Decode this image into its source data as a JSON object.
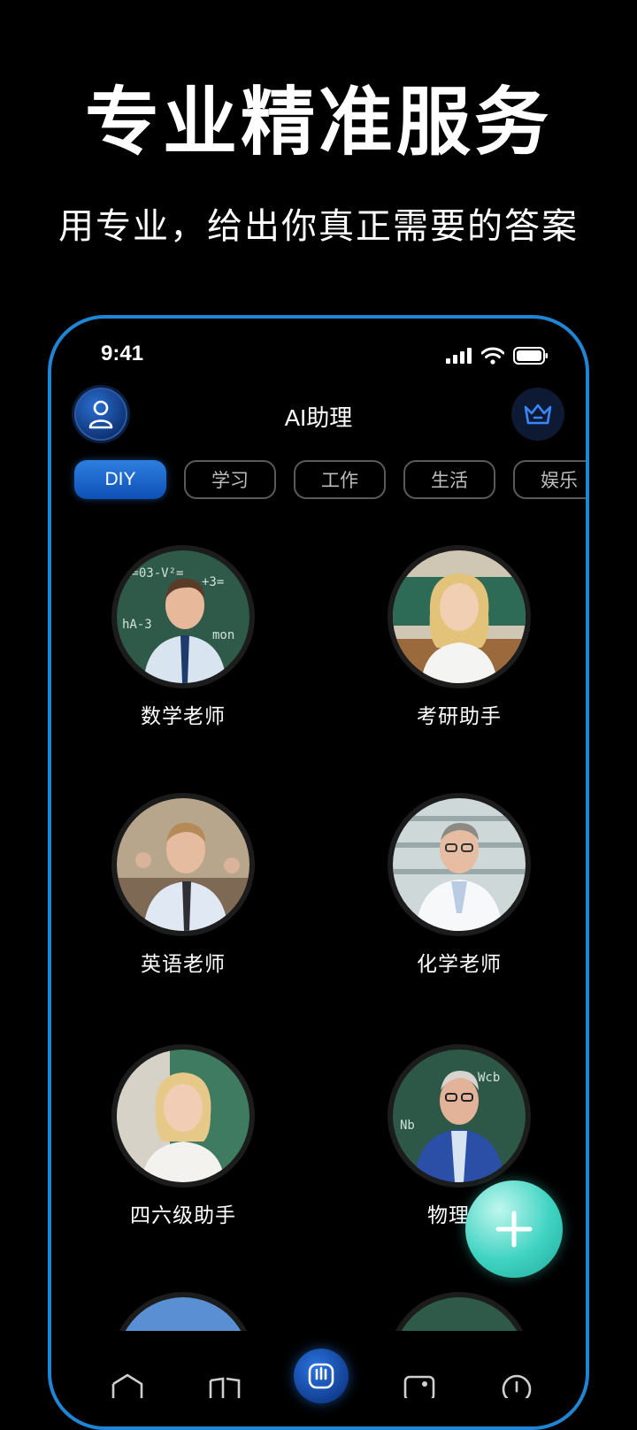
{
  "promo": {
    "headline": "专业精准服务",
    "subline": "用专业，给出你真正需要的答案"
  },
  "status_bar": {
    "time": "9:41"
  },
  "header": {
    "title": "AI助理"
  },
  "tabs": [
    {
      "label": "DIY",
      "active": true
    },
    {
      "label": "学习"
    },
    {
      "label": "工作"
    },
    {
      "label": "生活"
    },
    {
      "label": "娱乐"
    }
  ],
  "assistants": [
    {
      "label": "数学老师"
    },
    {
      "label": "考研助手"
    },
    {
      "label": "英语老师"
    },
    {
      "label": "化学老师"
    },
    {
      "label": "四六级助手"
    },
    {
      "label": "物理老"
    }
  ],
  "colors": {
    "accent": "#1f86d6",
    "tab_active": "#1a5fc8",
    "fab": "#3fd3c2"
  }
}
